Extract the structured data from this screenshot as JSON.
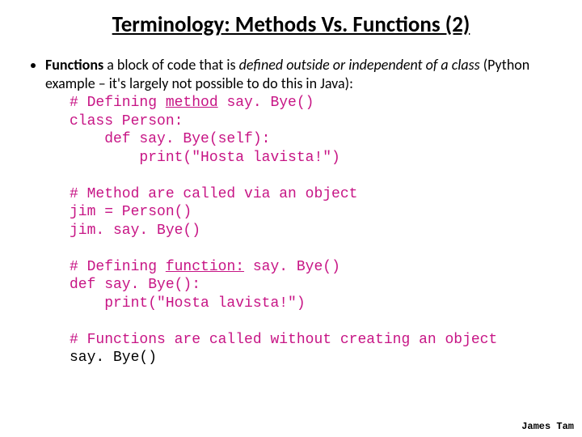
{
  "title": "Terminology: Methods Vs. Functions (2)",
  "bullet": {
    "lead": "Functions",
    "rest1": " a block of code that is ",
    "defined": "defined outside or independent of a class",
    "rest2": " (Python example – it's largely not possible to do this in Java):"
  },
  "code": {
    "c1a": "# Defining ",
    "c1b": "method",
    "c1c": " say. Bye()",
    "c2": "class Person:",
    "c3": "    def say. Bye(self):",
    "c4": "        print(\"Hosta lavista!\")",
    "c5": "# Method are called via an object",
    "c6": "jim = Person()",
    "c7": "jim. say. Bye()",
    "c8a": "# Defining ",
    "c8b": "function:",
    "c8c": " say. Bye()",
    "c9": "def say. Bye():",
    "c10": "    print(\"Hosta lavista!\")",
    "c11": "# Functions are called without creating an object",
    "c12": "say. Bye()"
  },
  "footer": "James Tam"
}
